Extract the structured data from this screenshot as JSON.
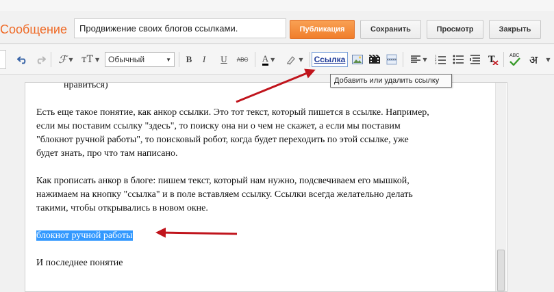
{
  "header": {
    "page_title": "Сообщение",
    "post_title_value": "Продвижение своих блогов ссылками.",
    "buttons": {
      "publish": "Публикация",
      "save": "Сохранить",
      "preview": "Просмотр",
      "close": "Закрыть"
    }
  },
  "toolbar": {
    "font_size_glyph": "тТ",
    "font_family_glyph": "ℱ",
    "format_select_value": "Обычный",
    "bold": "B",
    "italic": "I",
    "underline": "U",
    "strike": "ABC",
    "text_color": "A",
    "link_label": "Ссылка",
    "spellcheck": "ABC",
    "hindi_char": "अ",
    "tooltip": "Добавить или удалить ссылку"
  },
  "editor": {
    "lines": {
      "top_fragment": "нравиться)",
      "p1_l1": "Есть еще такое понятие, как анкор ссылки. Это тот текст, который пишется в ссылке. Например,",
      "p1_l2": "если мы поставим ссылку \"здесь\", то поиску она ни о чем не скажет, а если мы поставим",
      "p1_l3": "\"блокнот ручной работы\", то поисковый робот, когда будет переходить по этой ссылке, уже",
      "p1_l4": "будет знать, про что там написано.",
      "p2_l1": "Как прописать анкор в блоге: пишем текст, который нам нужно, подсвечиваем его мышкой,",
      "p2_l2": "нажимаем на кнопку \"ссылка\" и в поле вставляем ссылку. Ссылки всегда желательно делать",
      "p2_l3": "такими, чтобы открывались в новом окне.",
      "selected_text": "блокнот ручной работы",
      "last_line": "И последнее понятие"
    }
  },
  "colors": {
    "accent_orange": "#f07e2b",
    "selection_blue": "#3399ff",
    "annotation_red": "#c0141c"
  }
}
